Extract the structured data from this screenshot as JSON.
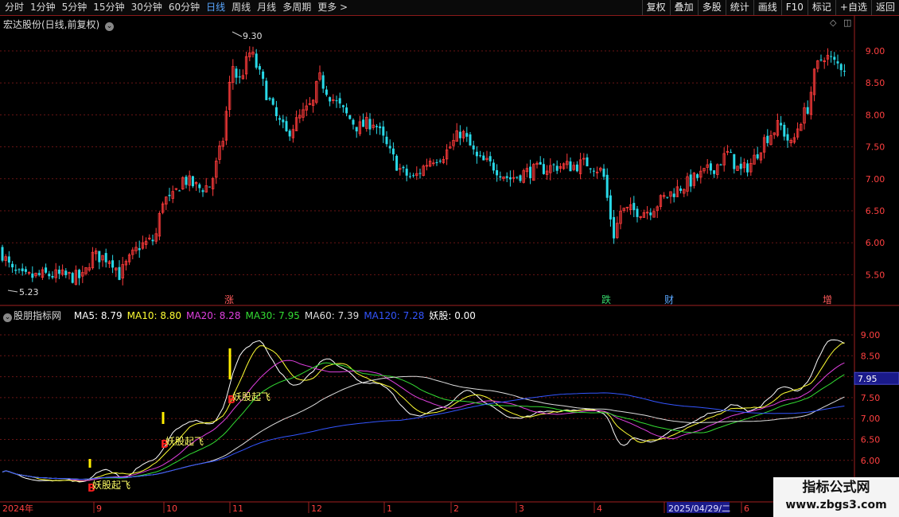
{
  "toolbar": {
    "tabs": [
      "分时",
      "1分钟",
      "5分钟",
      "15分钟",
      "30分钟",
      "60分钟",
      "日线",
      "周线",
      "月线",
      "多周期",
      "更多 >"
    ],
    "active_tab": "日线",
    "right_buttons": [
      "复权",
      "叠加",
      "多股",
      "统计",
      "画线",
      "F10",
      "标记",
      "+自选",
      "返回"
    ]
  },
  "main_panel": {
    "title": "宏达股份(日线,前复权)",
    "high_label": "9.30",
    "low_label": "5.23",
    "events": [
      {
        "label": "涨",
        "color": "#ff5a5a"
      },
      {
        "label": "跌",
        "color": "#36d46a"
      },
      {
        "label": "财",
        "color": "#5aa7ff"
      },
      {
        "label": "增",
        "color": "#ff5a5a"
      }
    ],
    "yticks": [
      "9.00",
      "8.50",
      "8.00",
      "7.50",
      "7.00",
      "6.50",
      "6.00",
      "5.50"
    ]
  },
  "indicator_panel": {
    "title": "股朋指标网",
    "legend": [
      {
        "text": "MA5: 8.79",
        "color": "#ffffff"
      },
      {
        "text": "MA10: 8.80",
        "color": "#ffff33"
      },
      {
        "text": "MA20: 8.28",
        "color": "#e040e0"
      },
      {
        "text": "MA30: 7.95",
        "color": "#33dd33"
      },
      {
        "text": "MA60: 7.39",
        "color": "#dddddd"
      },
      {
        "text": "MA120: 7.28",
        "color": "#3355ff"
      },
      {
        "text": "妖股: 0.00",
        "color": "#ffffff"
      }
    ],
    "yticks": [
      "9.00",
      "8.50",
      "8.00",
      "7.50",
      "7.00",
      "6.50",
      "6.00"
    ],
    "current_value": "7.95",
    "signals": [
      {
        "marker": "B",
        "text": "妖股起飞"
      },
      {
        "marker": "B",
        "text": "妖股起飞"
      },
      {
        "marker": "B",
        "text": "妖股起飞"
      }
    ]
  },
  "time_axis": {
    "labels": [
      "2024年",
      "9",
      "10",
      "11",
      "12",
      "1",
      "2",
      "3",
      "4",
      "2025/04/29/二",
      "6"
    ]
  },
  "watermark": {
    "line1": "指标公式网",
    "line2": "www.zbgs3.com"
  },
  "chart_data": {
    "type": "candlestick",
    "title": "宏达股份(日线,前复权)",
    "y_range": [
      5.23,
      9.3
    ],
    "highest": 9.3,
    "lowest": 5.23,
    "close_path": [
      {
        "x": "2024/07",
        "y": 5.9
      },
      {
        "x": "2024/08",
        "y": 5.45
      },
      {
        "x": "2024/08/末",
        "y": 5.5
      },
      {
        "x": "2024/09",
        "y": 6.05
      },
      {
        "x": "2024/09/末",
        "y": 6.2
      },
      {
        "x": "2024/10",
        "y": 7.1
      },
      {
        "x": "2024/10/末",
        "y": 6.9
      },
      {
        "x": "2024/11",
        "y": 8.8
      },
      {
        "x": "2024/11/中",
        "y": 8.4
      },
      {
        "x": "2024/12",
        "y": 8.2
      },
      {
        "x": "2024/12/末",
        "y": 8.0
      },
      {
        "x": "2025/01",
        "y": 7.2
      },
      {
        "x": "2025/02",
        "y": 7.6
      },
      {
        "x": "2025/03",
        "y": 7.2
      },
      {
        "x": "2025/04",
        "y": 7.15
      },
      {
        "x": "2025/04/07",
        "y": 6.2
      },
      {
        "x": "2025/04/末",
        "y": 6.6
      },
      {
        "x": "2025/05",
        "y": 7.0
      },
      {
        "x": "2025/06",
        "y": 7.4
      },
      {
        "x": "2025/06/末",
        "y": 8.0
      },
      {
        "x": "2025/07",
        "y": 8.8
      }
    ],
    "indicator_series": [
      {
        "name": "MA5",
        "last": 8.79
      },
      {
        "name": "MA10",
        "last": 8.8
      },
      {
        "name": "MA20",
        "last": 8.28
      },
      {
        "name": "MA30",
        "last": 7.95
      },
      {
        "name": "MA60",
        "last": 7.39
      },
      {
        "name": "MA120",
        "last": 7.28
      }
    ]
  },
  "colors": {
    "up": "#ff3b3b",
    "down": "#29d9e8",
    "grid": "#7a1a1a",
    "frame": "#a02020"
  }
}
